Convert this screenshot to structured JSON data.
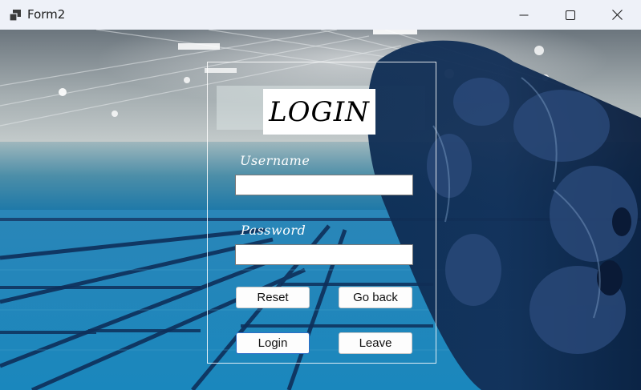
{
  "window": {
    "title": "Form2",
    "controls": {
      "minimize_icon": "minimize-icon",
      "maximize_icon": "maximize-icon",
      "close_icon": "close-icon"
    }
  },
  "login": {
    "heading": "LOGIN",
    "username_label": "Username",
    "username_value": "",
    "password_label": "Password",
    "password_value": "",
    "buttons": {
      "reset": "Reset",
      "go_back": "Go back",
      "login": "Login",
      "leave": "Leave"
    }
  },
  "colors": {
    "titlebar_bg": "#eef1f8",
    "water": "#1b7fb4",
    "panel_border": "#ffffff",
    "focus_border": "#2f6ec8"
  }
}
